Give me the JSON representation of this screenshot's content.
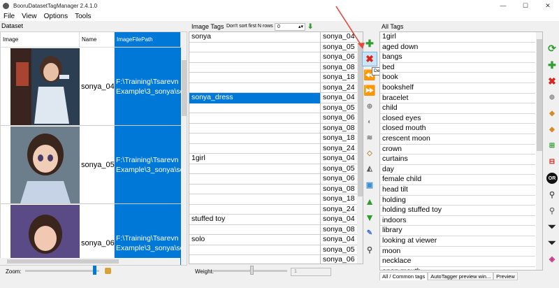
{
  "window": {
    "title": "BooruDatasetTagManager 2.4.1.0",
    "minimize": "—",
    "maximize": "☐",
    "close": "✕"
  },
  "menu": [
    "File",
    "View",
    "Options",
    "Tools"
  ],
  "dataset": {
    "label": "Dataset",
    "columns": [
      "Image",
      "Name",
      "ImageFilePath"
    ],
    "rows": [
      {
        "name": "sonya_04",
        "path1": "F:\\Training\\Tsarevn",
        "path2": "Example\\3_sonya\\so"
      },
      {
        "name": "sonya_05",
        "path1": "F:\\Training\\Tsarevn",
        "path2": "Example\\3_sonya\\so"
      },
      {
        "name": "sonya_06",
        "path1": "F:\\Training\\Tsarevn",
        "path2": "Example\\3_sonya\\so"
      }
    ],
    "zoom_label": "Zoom:"
  },
  "image_tags": {
    "label": "Image Tags",
    "dont_sort_label": "Don't sort first N rows :",
    "dont_sort_value": "0",
    "rows": [
      {
        "tag": "sonya",
        "file": "sonya_04"
      },
      {
        "tag": "",
        "file": "sonya_05"
      },
      {
        "tag": "",
        "file": "sonya_06"
      },
      {
        "tag": "",
        "file": "sonya_08"
      },
      {
        "tag": "",
        "file": "sonya_18"
      },
      {
        "tag": "",
        "file": "sonya_24"
      },
      {
        "tag": "sonya_dress",
        "file": "sonya_04"
      },
      {
        "tag": "",
        "file": "sonya_05"
      },
      {
        "tag": "",
        "file": "sonya_06"
      },
      {
        "tag": "",
        "file": "sonya_08"
      },
      {
        "tag": "",
        "file": "sonya_18"
      },
      {
        "tag": "",
        "file": "sonya_24"
      },
      {
        "tag": "1girl",
        "file": "sonya_04"
      },
      {
        "tag": "",
        "file": "sonya_05"
      },
      {
        "tag": "",
        "file": "sonya_06"
      },
      {
        "tag": "",
        "file": "sonya_08"
      },
      {
        "tag": "",
        "file": "sonya_18"
      },
      {
        "tag": "",
        "file": "sonya_24"
      },
      {
        "tag": "stuffed toy",
        "file": "sonya_04"
      },
      {
        "tag": "",
        "file": "sonya_08"
      },
      {
        "tag": "solo",
        "file": "sonya_04"
      },
      {
        "tag": "",
        "file": "sonya_05"
      },
      {
        "tag": "",
        "file": "sonya_06"
      }
    ],
    "weight_label": "Weight:",
    "weight_value": "1"
  },
  "tooltip": "Delete Tag (Ctrl+D)",
  "all_tags": {
    "label": "All Tags",
    "items": [
      "1girl",
      "aged down",
      "bangs",
      "bed",
      "book",
      "bookshelf",
      "bracelet",
      "child",
      "closed eyes",
      "closed mouth",
      "crescent moon",
      "crown",
      "curtains",
      "day",
      "female child",
      "head tilt",
      "holding",
      "holding stuffed toy",
      "indoors",
      "library",
      "looking at viewer",
      "moon",
      "necklace",
      "open mouth"
    ]
  },
  "bottom_tabs": [
    "All / Common tags",
    "AutoTagger preview win...",
    "Preview"
  ],
  "colors": {
    "selection": "#0078d7",
    "accent_green": "#2e9e2e",
    "accent_red": "#d9261c",
    "accent_blue": "#1b6fd1"
  }
}
